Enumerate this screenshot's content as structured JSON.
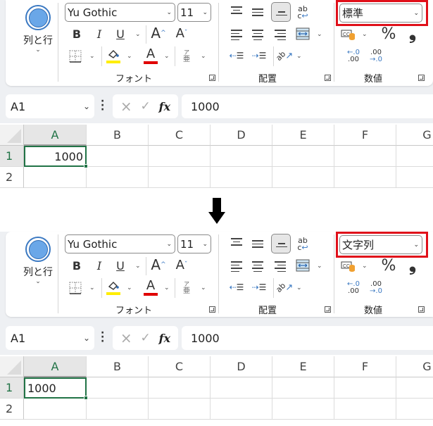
{
  "caption_arrow": "down-arrow-icon",
  "panels": [
    {
      "id": "before",
      "ribbon": {
        "rows_cols_button": {
          "label": "列と行",
          "icon": "circle-icon"
        },
        "font": {
          "font_name": "Yu Gothic",
          "font_size": "11",
          "bold": "B",
          "italic": "I",
          "underline": "U",
          "grow": "A",
          "shrink": "A",
          "font_color_letter": "A",
          "phonetic_top": "ア",
          "phonetic_bottom": "亜",
          "group_label": "フォント",
          "fill_color": "#ffee00",
          "font_color": "#e00000"
        },
        "alignment": {
          "group_label": "配置",
          "wrap_text": "ab",
          "wrap_c": "c"
        },
        "number": {
          "format": "標準",
          "percent": "%",
          "comma": "❟",
          "inc_decimal_top": "←.0",
          "inc_decimal_bottom": ".00",
          "dec_decimal_top": ".00",
          "dec_decimal_bottom": "→.0",
          "group_label": "数値"
        }
      },
      "formula_bar": {
        "name_box": "A1",
        "cancel": "×",
        "enter": "✓",
        "fx": "fx",
        "value": "1000"
      },
      "grid": {
        "columns": [
          "A",
          "B",
          "C",
          "D",
          "E",
          "F",
          "G"
        ],
        "rows": [
          "1",
          "2"
        ],
        "cell_A1": "1000",
        "cell_A1_align": "right"
      }
    },
    {
      "id": "after",
      "ribbon": {
        "rows_cols_button": {
          "label": "列と行",
          "icon": "circle-icon"
        },
        "font": {
          "font_name": "Yu Gothic",
          "font_size": "11",
          "bold": "B",
          "italic": "I",
          "underline": "U",
          "grow": "A",
          "shrink": "A",
          "font_color_letter": "A",
          "phonetic_top": "ア",
          "phonetic_bottom": "亜",
          "group_label": "フォント",
          "fill_color": "#ffee00",
          "font_color": "#e00000"
        },
        "alignment": {
          "group_label": "配置",
          "wrap_text": "ab",
          "wrap_c": "c"
        },
        "number": {
          "format": "文字列",
          "percent": "%",
          "comma": "❟",
          "inc_decimal_top": "←.0",
          "inc_decimal_bottom": ".00",
          "dec_decimal_top": ".00",
          "dec_decimal_bottom": "→.0",
          "group_label": "数値"
        }
      },
      "formula_bar": {
        "name_box": "A1",
        "cancel": "×",
        "enter": "✓",
        "fx": "fx",
        "value": "1000"
      },
      "grid": {
        "columns": [
          "A",
          "B",
          "C",
          "D",
          "E",
          "F",
          "G"
        ],
        "rows": [
          "1",
          "2"
        ],
        "cell_A1": "1000",
        "cell_A1_align": "left"
      }
    }
  ],
  "colors": {
    "highlight_box": "#e0101a",
    "selection": "#217346",
    "accent_blue": "#3b79c2"
  }
}
